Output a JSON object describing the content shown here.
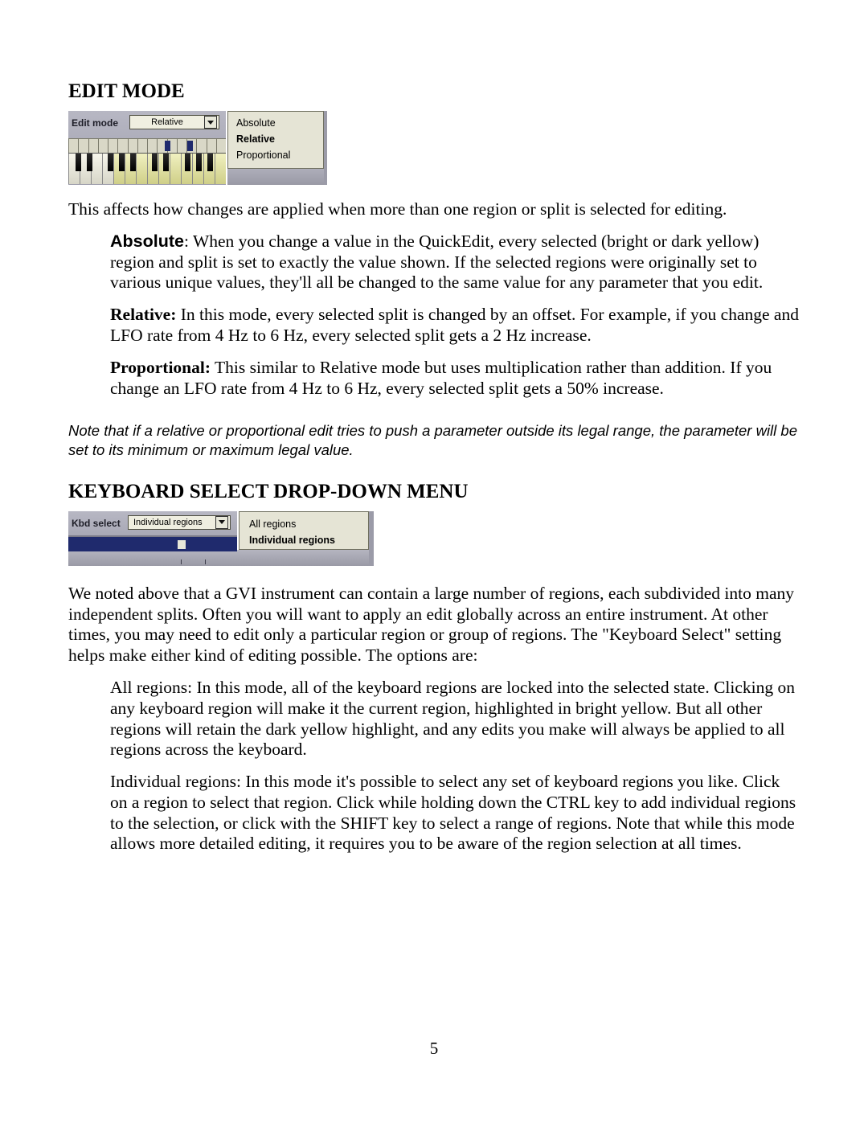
{
  "section1": {
    "heading": "EDIT MODE",
    "fig": {
      "label": "Edit mode",
      "selected": "Relative",
      "options": [
        "Absolute",
        "Relative",
        "Proportional"
      ]
    },
    "intro": "This affects how changes are applied when more than one region or split is selected for editing.",
    "absolute_label": "Absolute",
    "absolute_body": ": When you change a value in the QuickEdit, every selected (bright or dark yellow) region and split is set to exactly the value shown. If the selected regions were originally set to various unique values, they'll all be changed to the same value for any parameter that you edit.",
    "relative_label": "Relative:",
    "relative_body": " In this mode, every selected split is changed by an offset. For example, if you change and LFO rate from 4 Hz to 6 Hz, every selected split gets a 2 Hz increase.",
    "proportional_label": "Proportional:",
    "proportional_body": " This similar to Relative mode but uses multiplication rather than addition. If you change an LFO rate from 4 Hz to 6 Hz, every selected split gets a 50% increase.",
    "note": "Note that if a relative or proportional edit tries to push a parameter outside its legal range, the parameter will be set to its minimum or maximum legal value."
  },
  "section2": {
    "heading": "KEYBOARD SELECT DROP-DOWN MENU",
    "fig": {
      "label": "Kbd select",
      "selected": "Individual regions",
      "options": [
        "All regions",
        "Individual regions"
      ]
    },
    "intro": "We noted above that a GVI instrument can contain a large number of regions, each subdivided into many independent splits. Often you will want to apply an edit globally across an entire instrument. At other times, you may need to edit only a particular region or group of regions. The \"Keyboard Select\" setting helps make either kind of editing possible. The options are:",
    "allregions_label": "All regions:",
    "allregions_body": " In this mode, all of the keyboard regions are locked into the selected state. Clicking on any keyboard region will make it the current region, highlighted in bright yellow. But all other regions will retain the dark yellow highlight, and any edits you make will always be applied to all regions across the keyboard.",
    "indregions_label": "Individual regions:",
    "indregions_body": " In this mode it's possible to select any set of keyboard regions you like. Click on a region to select that region. Click while holding down the CTRL key to add individual regions to the selection, or click with the SHIFT key to select a range of regions. Note that while this mode allows more detailed editing, it requires you to be aware of the region selection at all times."
  },
  "page_number": "5"
}
